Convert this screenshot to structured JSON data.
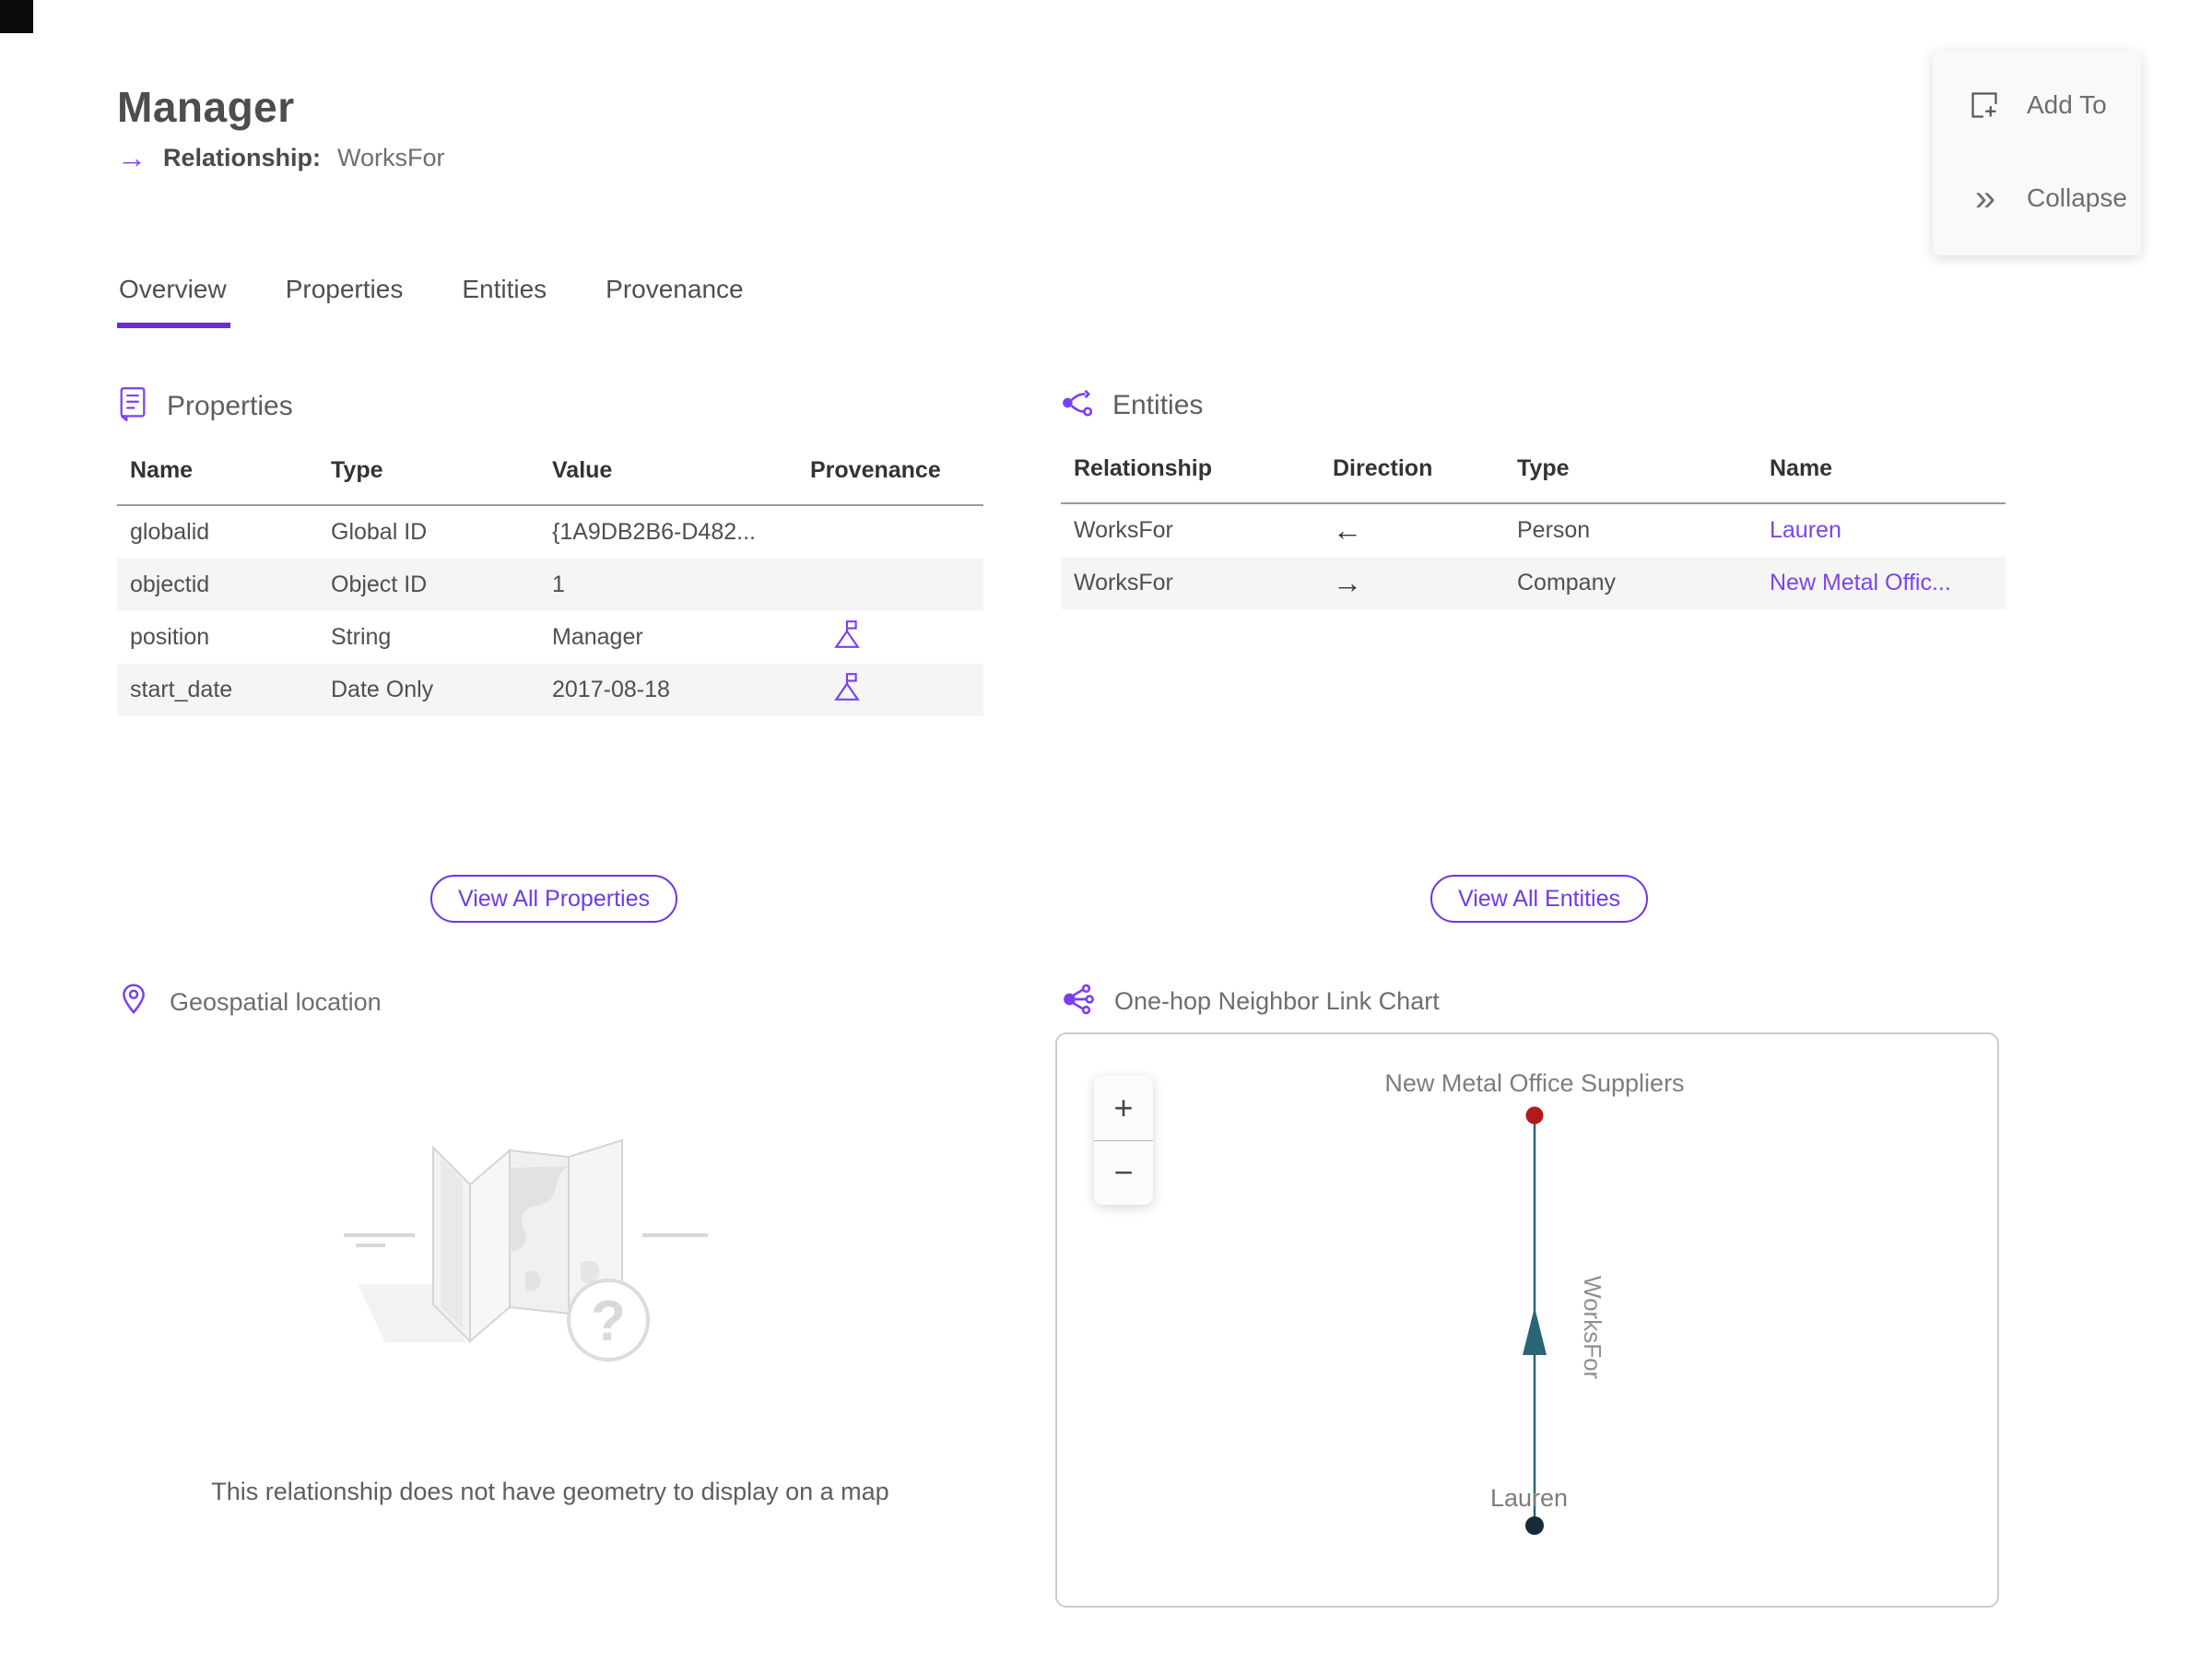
{
  "header": {
    "title": "Manager",
    "relationship_label": "Relationship:",
    "relationship_value": "WorksFor"
  },
  "icons": {
    "subtitle_arrow": "→",
    "collapse_glyph": "»",
    "zoom_in": "+",
    "zoom_out": "−",
    "question_mark": "?"
  },
  "actions": {
    "add_to": "Add To",
    "collapse": "Collapse"
  },
  "tabs": [
    {
      "label": "Overview",
      "active": true
    },
    {
      "label": "Properties"
    },
    {
      "label": "Entities"
    },
    {
      "label": "Provenance"
    }
  ],
  "properties_section": {
    "title": "Properties",
    "columns": {
      "name": "Name",
      "type": "Type",
      "value": "Value",
      "provenance": "Provenance"
    },
    "rows": [
      {
        "name": "globalid",
        "type": "Global ID",
        "value": "{1A9DB2B6-D482...",
        "provenance": false
      },
      {
        "name": "objectid",
        "type": "Object ID",
        "value": "1",
        "provenance": false
      },
      {
        "name": "position",
        "type": "String",
        "value": "Manager",
        "provenance": true
      },
      {
        "name": "start_date",
        "type": "Date Only",
        "value": "2017-08-18",
        "provenance": true
      }
    ],
    "view_all_label": "View All Properties"
  },
  "entities_section": {
    "title": "Entities",
    "columns": {
      "relationship": "Relationship",
      "direction": "Direction",
      "type": "Type",
      "name": "Name"
    },
    "rows": [
      {
        "relationship": "WorksFor",
        "direction": "←",
        "type": "Person",
        "name": "Lauren"
      },
      {
        "relationship": "WorksFor",
        "direction": "→",
        "type": "Company",
        "name": "New Metal Offic..."
      }
    ],
    "view_all_label": "View All Entities"
  },
  "geospatial_section": {
    "title": "Geospatial location",
    "empty_message": "This relationship does not have geometry to display on a map"
  },
  "link_chart_section": {
    "title": "One-hop Neighbor Link Chart",
    "top_node_label": "New Metal Office Suppliers",
    "bottom_node_label": "Lauren",
    "edge_label": "WorksFor",
    "top_node_color": "#b11a1a",
    "bottom_node_color": "#152b3a",
    "edge_color": "#2a6576"
  },
  "colors": {
    "accent_purple": "#6a2cd6",
    "link_purple": "#7b45ea",
    "edge_teal": "#2a6576",
    "node_red": "#b11a1a",
    "node_dark": "#152b3a"
  }
}
